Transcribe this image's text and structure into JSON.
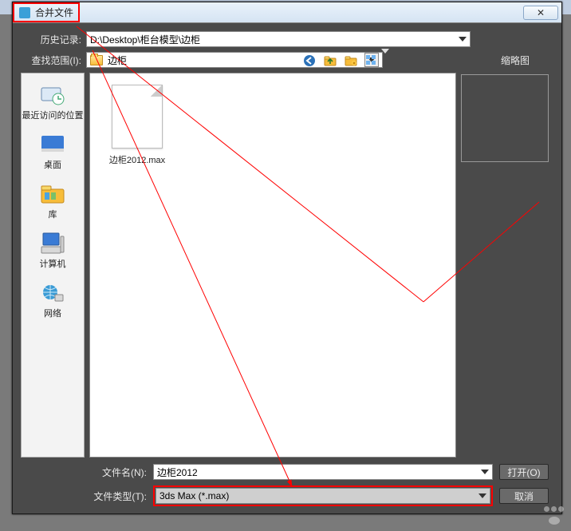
{
  "title": "合并文件",
  "closeGlyph": "✕",
  "history": {
    "label": "历史记录:",
    "value": "D:\\Desktop\\柜台模型\\边柜"
  },
  "scope": {
    "label": "查找范围(I):",
    "value": "边柜"
  },
  "toolbar": {
    "back": "back-icon",
    "up": "up-folder-icon",
    "newfolder": "new-folder-icon",
    "views": "views-icon"
  },
  "thumbnail": {
    "label": "缩略图"
  },
  "sidebar": [
    {
      "key": "recent",
      "label": "最近访问的位置"
    },
    {
      "key": "desktop",
      "label": "桌面"
    },
    {
      "key": "library",
      "label": "库"
    },
    {
      "key": "computer",
      "label": "计算机"
    },
    {
      "key": "network",
      "label": "网络"
    }
  ],
  "files": [
    {
      "name": "边柜2012.max"
    }
  ],
  "filename": {
    "label": "文件名(N):",
    "value": "边柜2012"
  },
  "filetype": {
    "label": "文件类型(T):",
    "value": "3ds Max (*.max)"
  },
  "buttons": {
    "open": "打开(O)",
    "cancel": "取消"
  }
}
